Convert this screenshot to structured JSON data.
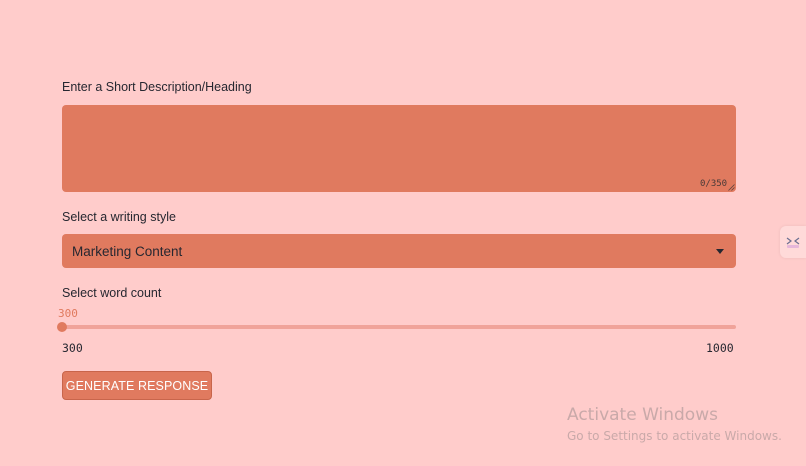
{
  "form": {
    "description": {
      "label": "Enter a Short Description/Heading",
      "value": "",
      "counter": "0/350"
    },
    "writing_style": {
      "label": "Select a writing style",
      "selected": "Marketing Content"
    },
    "word_count": {
      "label": "Select word count",
      "value": "300",
      "min": "300",
      "max": "1000"
    },
    "generate_label": "GENERATE RESPONSE"
  },
  "watermark": {
    "title": "Activate Windows",
    "subtitle": "Go to Settings to activate Windows."
  },
  "colors": {
    "background": "#ffcccb",
    "accent": "#e07a5f",
    "track": "#f0a39a"
  },
  "icons": {
    "side_widget": "streamlit-deploy-icon",
    "select_arrow": "chevron-down-icon"
  }
}
